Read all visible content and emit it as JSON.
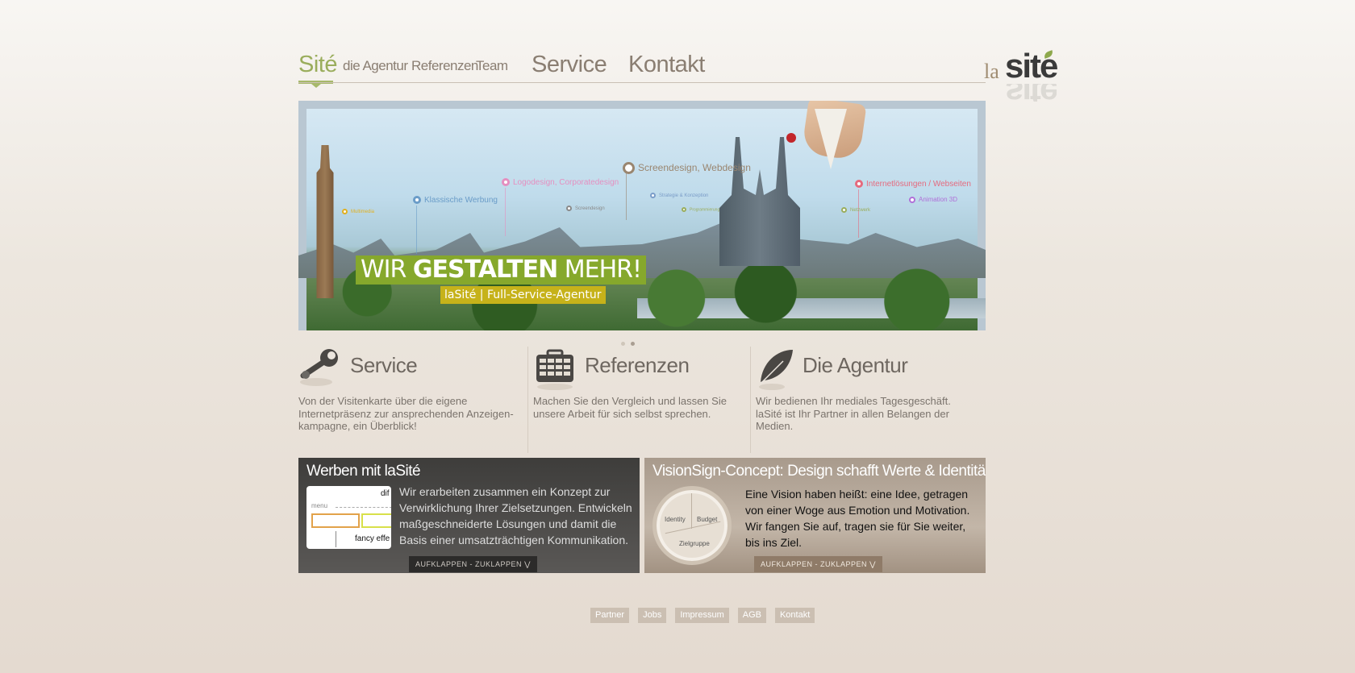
{
  "nav": {
    "site": "Sité",
    "agentur": "die Agentur",
    "referenzen": "Referenzen",
    "team": "Team",
    "service": "Service",
    "kontakt": "Kontakt"
  },
  "logo": {
    "la": "la",
    "site": "site"
  },
  "hero": {
    "headline_light1": "WIR ",
    "headline_bold": "GESTALTEN",
    "headline_light2": " MEHR!",
    "subline": "laSité | Full-Service-Agentur",
    "tags": {
      "screendesign": "Screendesign, Webdesign",
      "logodesign": "Logodesign, Corporatedesign",
      "internet": "Internetlösungen / Webseiten",
      "klassisch": "Klassische Werbung",
      "multimedia": "Multimedia",
      "animation": "Animation 3D",
      "strategie": "Strategie & Konzeption",
      "screen_small": "Screendesign",
      "netzwerk": "Netzwerk",
      "programmierung": "Programmierung"
    },
    "slide_count": 2,
    "active_slide": 2
  },
  "columns": [
    {
      "title": "Service",
      "text": "Von der Visitenkarte über die eigene Internetpräsenz zur ansprechenden Anzeigen-kampagne, ein Überblick!"
    },
    {
      "title": "Referenzen",
      "text": "Machen Sie den Vergleich und lassen Sie unsere Arbeit für sich selbst sprechen."
    },
    {
      "title": "Die Agentur",
      "text": "Wir bedienen Ihr mediales Tagesgeschäft. laSité ist Ihr Partner in allen Belangen der Medien."
    }
  ],
  "boxes": {
    "werben": {
      "title": "Werben mit laSité",
      "text": "Wir erarbeiten zusammen ein Konzept zur Verwirklichung Ihrer Zielsetzungen. Entwickeln maßgeschneiderte Lösungen und damit die Basis einer umsatzträchtigen Kommunikation.",
      "button": "AUFKLAPPEN - ZUKLAPPEN",
      "mock_menu": "menu",
      "mock_fancy": "fancy effe",
      "mock_dif": "dif"
    },
    "vision": {
      "title": "VisionSign-Concept: Design schafft Werte & Identität",
      "text": "Eine Vision haben heißt: eine Idee, getragen von einer Woge aus Emotion und Motivation. Wir fangen Sie auf, tragen sie für Sie weiter, bis ins Ziel.",
      "button": "AUFKLAPPEN - ZUKLAPPEN",
      "wheel": {
        "identity": "Identity",
        "budget": "Budget",
        "zielgruppe": "Zielgruppe"
      }
    }
  },
  "footer": [
    "Partner",
    "Jobs",
    "Impressum",
    "AGB",
    "Kontakt"
  ],
  "colors": {
    "accent_green": "#9aad5c",
    "dark_box": "#3e3d3b",
    "footer_btn": "#cbbfb2"
  }
}
